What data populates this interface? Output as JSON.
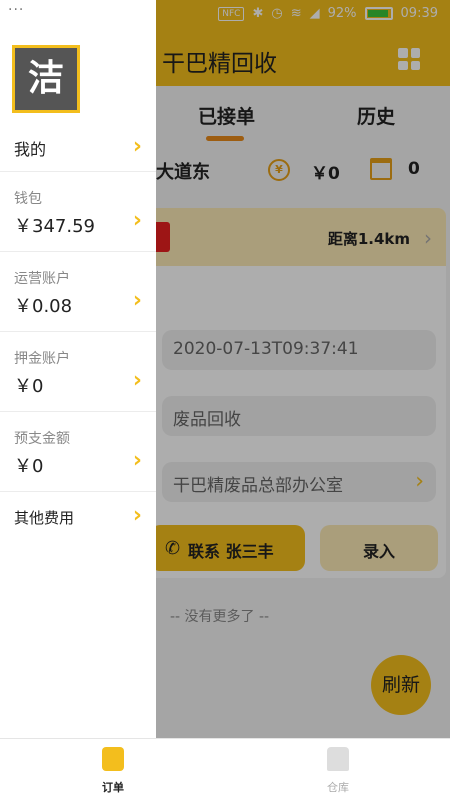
{
  "status_bar": {
    "nfc": "NFC",
    "battery": "92%",
    "time": "09:39"
  },
  "header": {
    "title": "干巴精回收"
  },
  "tabs": {
    "active": "已接单",
    "history": "历史"
  },
  "info_bar": {
    "address": "大道东",
    "amount": "￥0",
    "count": "0"
  },
  "order_card": {
    "distance": "距离1.4km",
    "time": "2020-07-13T09:37:41",
    "type": "废品回收",
    "location": "干巴精废品总部办公室",
    "contact_label": "联系 张三丰",
    "record_label": "录入"
  },
  "list_end": "-- 没有更多了 --",
  "refresh_label": "刷新",
  "drawer": {
    "menu_dots": "···",
    "avatar_char": "洁",
    "items": [
      {
        "label": "我的"
      },
      {
        "label": "钱包",
        "value": "￥347.59"
      },
      {
        "label": "运营账户",
        "value": "￥0.08"
      },
      {
        "label": "押金账户",
        "value": "￥0"
      },
      {
        "label": "预支金额",
        "value": "￥0"
      },
      {
        "label": "其他费用"
      }
    ]
  },
  "bottom_tabs": [
    {
      "label": "订单",
      "icon": "orders-icon"
    },
    {
      "label": "仓库",
      "icon": "warehouse-icon"
    }
  ],
  "colors": {
    "accent": "#f3be1d",
    "accent_light": "#fbe9b6",
    "tag_red": "#e81f1f"
  }
}
